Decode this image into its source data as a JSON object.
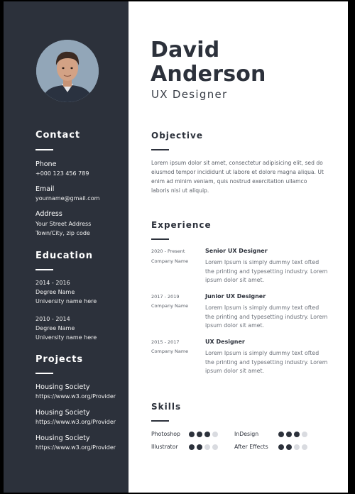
{
  "profile": {
    "first_name": "David",
    "last_name": "Anderson",
    "role": "UX Designer"
  },
  "contact": {
    "heading": "Contact",
    "phone_label": "Phone",
    "phone": "+000 123 456 789",
    "email_label": "Email",
    "email": "yourname@gmail.com",
    "address_label": "Address",
    "address_line1": "Your Street Address",
    "address_line2": "Town/City, zip code"
  },
  "education": {
    "heading": "Education",
    "items": [
      {
        "years": "2014 - 2016",
        "degree": "Degree Name",
        "school": "University name here"
      },
      {
        "years": "2010 - 2014",
        "degree": "Degree Name",
        "school": "University name here"
      }
    ]
  },
  "projects": {
    "heading": "Projects",
    "items": [
      {
        "name": "Housing Society",
        "url": "https://www.w3.org/Provider"
      },
      {
        "name": "Housing Society",
        "url": "https://www.w3.org/Provider"
      },
      {
        "name": "Housing Society",
        "url": "https://www.w3.org/Provider"
      }
    ]
  },
  "objective": {
    "heading": "Objective",
    "text": "Lorem ipsum dolor sit amet, consectetur adipisicing elit, sed do eiusmod tempor incididunt ut labore et dolore magna aliqua. Ut enim ad minim veniam, quis nostrud exercitation ullamco laboris nisi ut aliquip."
  },
  "experience": {
    "heading": "Experience",
    "items": [
      {
        "dates": "2020 - Present",
        "company": "Company Name",
        "title": "Senior UX Designer",
        "desc": "Lorem Ipsum is simply dummy text ofted the printing and typesetting industry. Lorem ipsum dolor sit amet."
      },
      {
        "dates": "2017 - 2019",
        "company": "Company Name",
        "title": "Junior UX Designer",
        "desc": "Lorem Ipsum is simply dummy text ofted the printing and typesetting industry. Lorem ipsum dolor sit amet."
      },
      {
        "dates": "2015 - 2017",
        "company": "Company Name",
        "title": "UX Designer",
        "desc": "Lorem Ipsum is simply dummy text ofted the printing and typesetting industry. Lorem ipsum dolor sit amet."
      }
    ]
  },
  "skills": {
    "heading": "Skills",
    "items": [
      {
        "name": "Photoshop",
        "level": 3,
        "max": 4
      },
      {
        "name": "InDesign",
        "level": 3,
        "max": 4
      },
      {
        "name": "Illustrator",
        "level": 2,
        "max": 4
      },
      {
        "name": "After Effects",
        "level": 2,
        "max": 4
      }
    ]
  },
  "colors": {
    "sidebar": "#2c313b",
    "accent": "#2c313b",
    "dot_inactive": "#d9dbe0"
  }
}
